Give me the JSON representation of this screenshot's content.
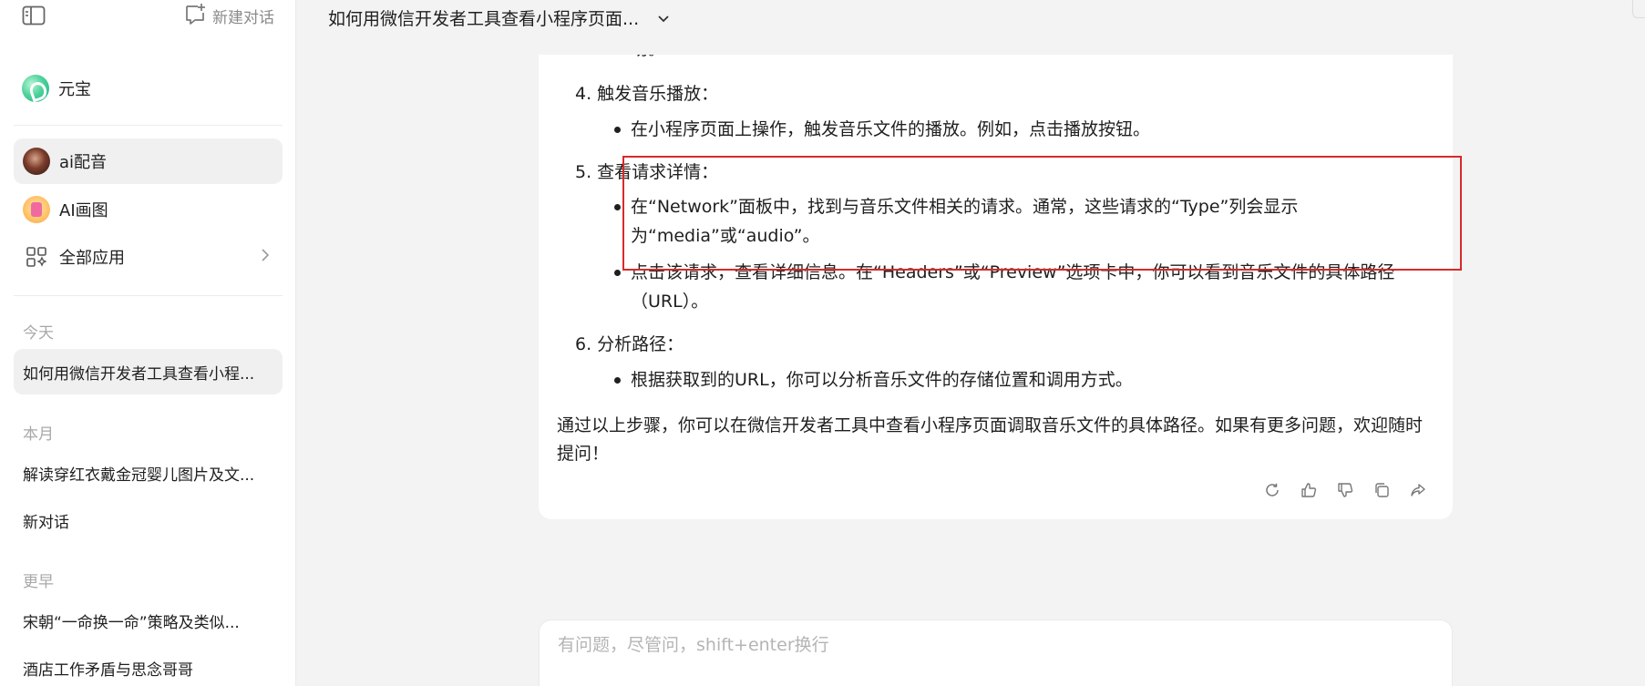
{
  "sidebar": {
    "new_chat_label": "新建对话",
    "brand_name": "元宝",
    "apps": [
      {
        "label": "ai配音",
        "icon": "voice-avatar"
      },
      {
        "label": "AI画图",
        "icon": "draw-avatar"
      },
      {
        "label": "全部应用",
        "icon": "apps-grid-icon"
      }
    ],
    "sections": {
      "today": "今天",
      "this_month": "本月",
      "earlier": "更早"
    },
    "conversations": {
      "today": [
        "如何用微信开发者工具查看小程..."
      ],
      "this_month": [
        "解读穿红衣戴金冠婴儿图片及文...",
        "新对话"
      ],
      "earlier": [
        "宋朝“一命换一命”策略及类似...",
        "酒店工作矛盾与思念哥哥"
      ]
    }
  },
  "header": {
    "title": "如何用微信开发者工具查看小程序页面..."
  },
  "message": {
    "clipped_top_line": "助。",
    "steps": [
      {
        "title": "4. 触发音乐播放：",
        "bullets": [
          "在小程序页面上操作，触发音乐文件的播放。例如，点击播放按钮。"
        ]
      },
      {
        "title": "5. 查看请求详情：",
        "bullets": [
          "在“Network”面板中，找到与音乐文件相关的请求。通常，这些请求的“Type”列会显示为“media”或“audio”。",
          "点击该请求，查看详细信息。在“Headers”或“Preview”选项卡中，你可以看到音乐文件的具体路径（URL）。"
        ]
      },
      {
        "title": "6. 分析路径：",
        "bullets": [
          "根据获取到的URL，你可以分析音乐文件的存储位置和调用方式。"
        ]
      }
    ],
    "summary": "通过以上步骤，你可以在微信开发者工具中查看小程序页面调取音乐文件的具体路径。如果有更多问题，欢迎随时提问！",
    "actions": [
      "refresh-icon",
      "thumbs-up-icon",
      "thumbs-down-icon",
      "copy-icon",
      "share-icon"
    ]
  },
  "input": {
    "placeholder": "有问题，尽管问，shift+enter换行",
    "value": ""
  },
  "colors": {
    "highlight_border": "#d82a2a",
    "sidebar_bg": "#ffffff",
    "page_bg": "#f3f3f3"
  }
}
